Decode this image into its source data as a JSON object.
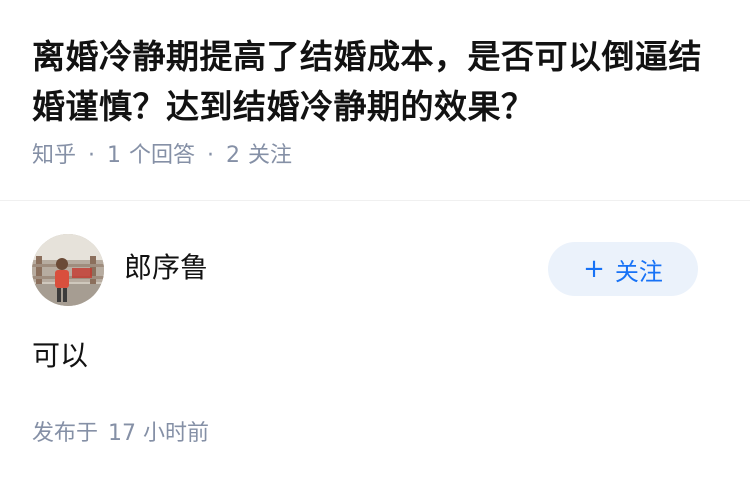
{
  "question": {
    "title": "离婚冷静期提高了结婚成本，是否可以倒逼结婚谨慎？达到结婚冷静期的效果？",
    "meta": {
      "source": "知乎",
      "answers_count": "1",
      "answers_label": "个回答",
      "followers_count": "2",
      "followers_label": "关注",
      "separator": "·"
    }
  },
  "answer": {
    "author": {
      "name": "郎序鲁",
      "avatar_icon": "person-photo-avatar"
    },
    "follow_button": {
      "plus": "+",
      "label": "关注"
    },
    "content": "可以",
    "published_label": "发布于",
    "published_time": "17 小时前"
  },
  "colors": {
    "title": "#121212",
    "meta": "#8590a6",
    "follow_bg": "#ebf2fb",
    "follow_text": "#1772f6",
    "divider": "#f0f0f0"
  }
}
